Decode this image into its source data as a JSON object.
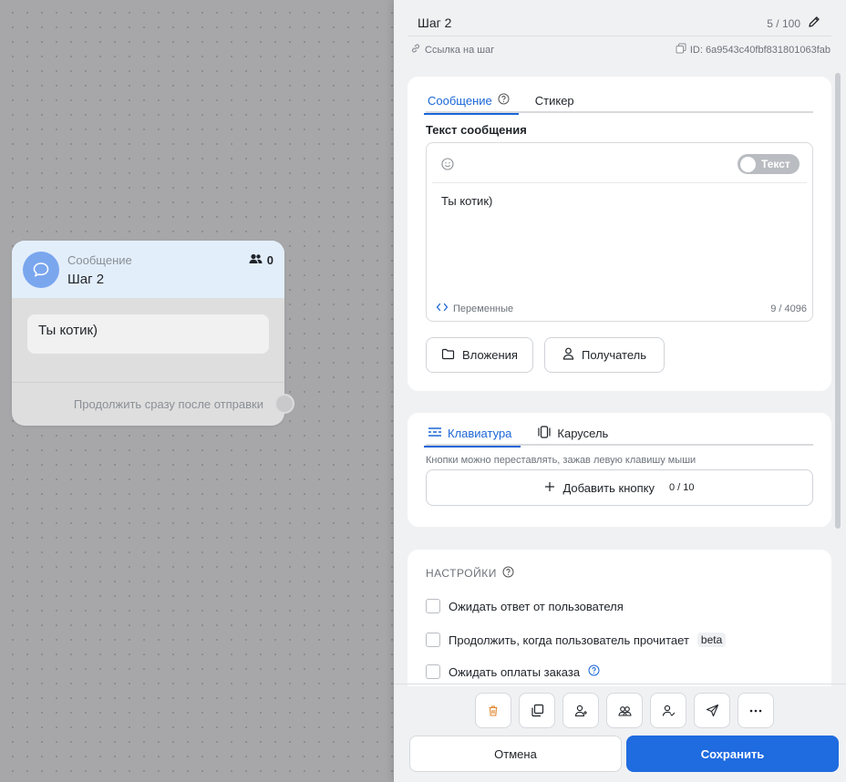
{
  "node": {
    "type": "Сообщение",
    "title": "Шаг 2",
    "subscribers": "0",
    "message": "Ты котик)",
    "continue_label": "Продолжить сразу после отправки",
    "icon": "chat-bubble-icon"
  },
  "panel": {
    "title": "Шаг 2",
    "title_count": "5 / 100",
    "link_label": "Ссылка на шаг",
    "id_label": "ID: 6a9543c40fbf831801063fab"
  },
  "message_card": {
    "tabs": [
      {
        "label": "Сообщение",
        "active": true
      },
      {
        "label": "Стикер",
        "active": false
      }
    ],
    "text_label": "Текст сообщения",
    "toggle_label": "Текст",
    "text_value": "Ты котик)",
    "variables_label": "Переменные",
    "char_count": "9 / 4096",
    "attachments_label": "Вложения",
    "recipient_label": "Получатель"
  },
  "keyboard_card": {
    "tabs": [
      {
        "label": "Клавиатура",
        "active": true
      },
      {
        "label": "Карусель",
        "active": false
      }
    ],
    "hint": "Кнопки можно переставлять, зажав левую клавишу мыши",
    "add_button_label": "Добавить кнопку",
    "add_button_count": "0 / 10"
  },
  "settings_card": {
    "title": "НАСТРОЙКИ",
    "options": [
      {
        "label": "Ожидать ответ от пользователя",
        "checked": false
      },
      {
        "label": "Продолжить, когда пользователь прочитает",
        "badge": "beta",
        "checked": false
      },
      {
        "label": "Ожидать оплаты заказа",
        "checked": false
      }
    ]
  },
  "footer": {
    "cancel_label": "Отмена",
    "save_label": "Сохранить",
    "toolbar_icons": [
      "trash-icon",
      "copy-icon",
      "user-add-icon",
      "group-icon",
      "user-check-icon",
      "send-icon",
      "more-icon"
    ]
  },
  "colors": {
    "accent": "#1f6be0",
    "tab_active": "#1a66d6",
    "node_header": "#e3eefb",
    "avatar": "#7aa6ee",
    "trash": "#e0862b"
  }
}
